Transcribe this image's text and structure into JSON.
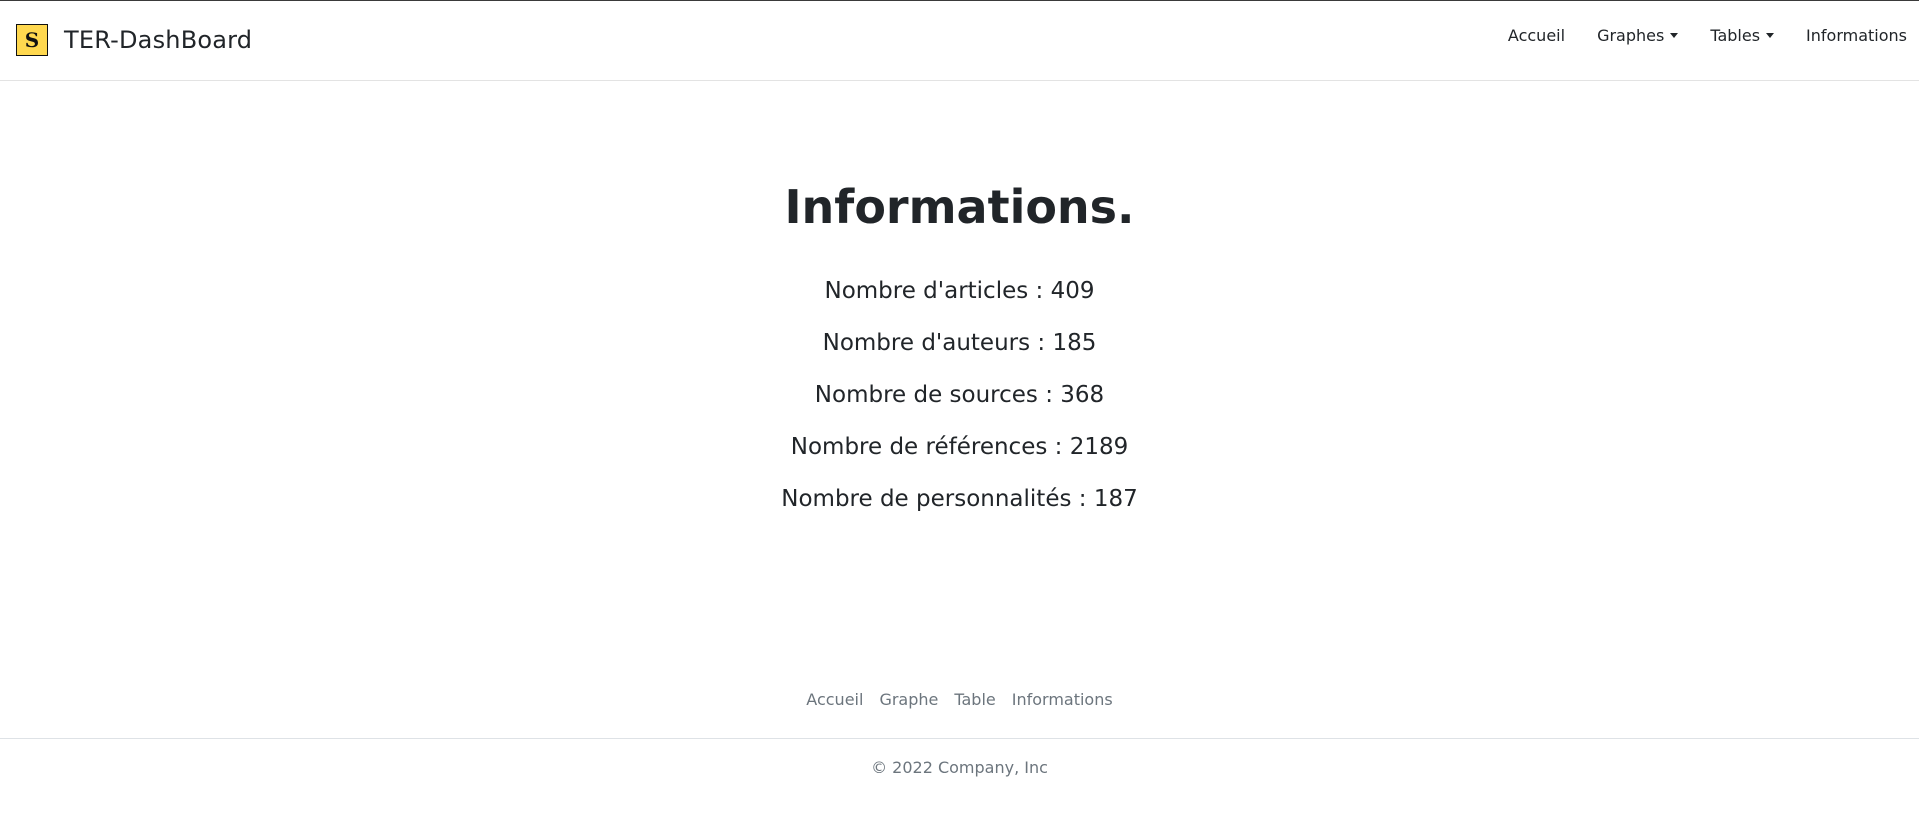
{
  "navbar": {
    "logo_letter": "S",
    "brand": "TER-DashBoard",
    "items": [
      {
        "label": "Accueil",
        "dropdown": false
      },
      {
        "label": "Graphes",
        "dropdown": true
      },
      {
        "label": "Tables",
        "dropdown": true
      },
      {
        "label": "Informations",
        "dropdown": false
      }
    ]
  },
  "main": {
    "title": "Informations.",
    "stats": [
      "Nombre d'articles : 409",
      "Nombre d'auteurs : 185",
      "Nombre de sources : 368",
      "Nombre de références : 2189",
      "Nombre de personnalités : 187"
    ]
  },
  "footer": {
    "links": [
      "Accueil",
      "Graphe",
      "Table",
      "Informations"
    ],
    "copyright": "© 2022 Company, Inc"
  },
  "colors": {
    "logo_bg": "#ffd84f",
    "text": "#212529",
    "muted": "#6c757d"
  },
  "icons": {
    "logo": "s-logo-icon",
    "dropdown": "caret-down-icon"
  }
}
